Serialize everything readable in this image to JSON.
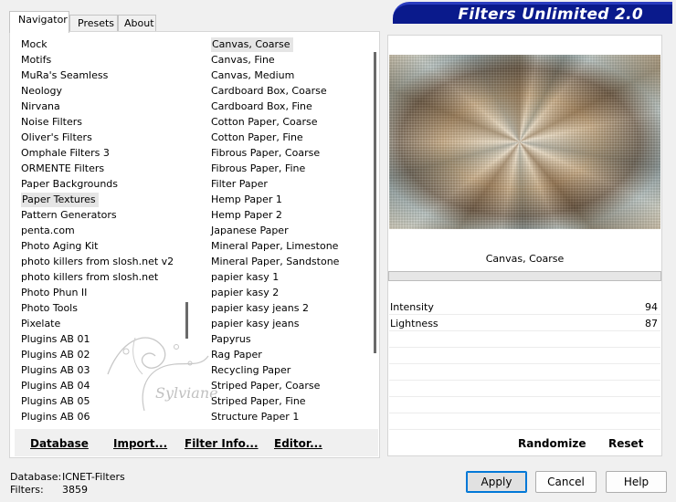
{
  "header": {
    "title": "Filters Unlimited 2.0"
  },
  "tabs": [
    {
      "label": "Navigator",
      "active": true
    },
    {
      "label": "Presets",
      "active": false
    },
    {
      "label": "About",
      "active": false
    }
  ],
  "categories": {
    "items": [
      "Mock",
      "Motifs",
      "MuRa's Seamless",
      "Neology",
      "Nirvana",
      "Noise Filters",
      "Oliver's Filters",
      "Omphale Filters 3",
      "ORMENTE Filters",
      "Paper Backgrounds",
      "Paper Textures",
      "Pattern Generators",
      "penta.com",
      "Photo Aging Kit",
      "photo killers from slosh.net v2",
      "photo killers from slosh.net",
      "Photo Phun II",
      "Photo Tools",
      "Pixelate",
      "Plugins AB 01",
      "Plugins AB 02",
      "Plugins AB 03",
      "Plugins AB 04",
      "Plugins AB 05",
      "Plugins AB 06"
    ],
    "selected": "Paper Textures"
  },
  "filters": {
    "items": [
      "Canvas, Coarse",
      "Canvas, Fine",
      "Canvas, Medium",
      "Cardboard Box, Coarse",
      "Cardboard Box, Fine",
      "Cotton Paper, Coarse",
      "Cotton Paper, Fine",
      "Fibrous Paper, Coarse",
      "Fibrous Paper, Fine",
      "Filter Paper",
      "Hemp Paper 1",
      "Hemp Paper 2",
      "Japanese Paper",
      "Mineral Paper, Limestone",
      "Mineral Paper, Sandstone",
      "papier kasy 1",
      "papier kasy 2",
      "papier kasy jeans 2",
      "papier kasy jeans",
      "Papyrus",
      "Rag Paper",
      "Recycling Paper",
      "Striped Paper, Coarse",
      "Striped Paper, Fine",
      "Structure Paper 1"
    ],
    "selected": "Canvas, Coarse"
  },
  "toolbar": {
    "database": "Database",
    "import": "Import...",
    "filter_info": "Filter Info...",
    "editor": "Editor..."
  },
  "preview": {
    "filter_name": "Canvas, Coarse",
    "params": [
      {
        "label": "Intensity",
        "value": "94"
      },
      {
        "label": "Lightness",
        "value": "87"
      }
    ],
    "randomize": "Randomize",
    "reset": "Reset"
  },
  "footer": {
    "database_label": "Database:",
    "database_value": "ICNET-Filters",
    "filters_label": "Filters:",
    "filters_value": "3859",
    "apply": "Apply",
    "cancel": "Cancel",
    "help": "Help"
  },
  "watermark_text": "Sylviane",
  "colors": {
    "banner": "#0a1a8c",
    "default_button_border": "#0078d7"
  }
}
